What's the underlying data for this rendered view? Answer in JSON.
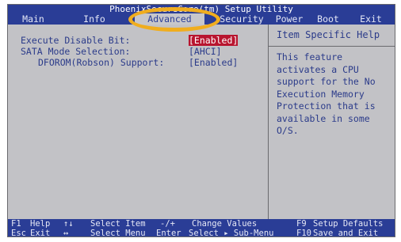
{
  "title": "PhoenixSecureCore(tm) Setup Utility",
  "menu": {
    "tabs": [
      {
        "label": "Main"
      },
      {
        "label": "Info"
      },
      {
        "label": "Advanced"
      },
      {
        "label": "Security"
      },
      {
        "label": "Power"
      },
      {
        "label": "Boot"
      },
      {
        "label": "Exit"
      }
    ],
    "active_tab": "Advanced"
  },
  "settings": [
    {
      "label": "Execute Disable Bit:",
      "value": "[Enabled]",
      "selected": true
    },
    {
      "label": "SATA Mode Selection:",
      "value": "[AHCI]",
      "selected": false
    },
    {
      "label": "DFOROM(Robson) Support:",
      "value": "[Enabled]",
      "selected": false
    }
  ],
  "help": {
    "title": "Item Specific Help",
    "text": "This feature activates a CPU support for the No Execution Memory Protection that is available in some O/S."
  },
  "status_bar": {
    "line1": [
      {
        "key": "F1",
        "label": "Help"
      },
      {
        "key": "↑↓",
        "label": "Select Item"
      },
      {
        "key": "-/+",
        "label": "Change Values"
      },
      {
        "key": "F9",
        "label": "Setup Defaults"
      }
    ],
    "line2": [
      {
        "key": "Esc",
        "label": "Exit"
      },
      {
        "key": "↔",
        "label": "Select Menu"
      },
      {
        "key": "Enter",
        "label": "Select ▸ Sub-Menu"
      },
      {
        "key": "F10",
        "label": "Save and Exit"
      }
    ]
  },
  "colors": {
    "bar_blue": "#2a3d96",
    "panel_gray": "#c2c2c6",
    "text_blue": "#2b3b8a",
    "selected_red": "#b8152f",
    "highlight_orange": "#f0ad1e"
  }
}
